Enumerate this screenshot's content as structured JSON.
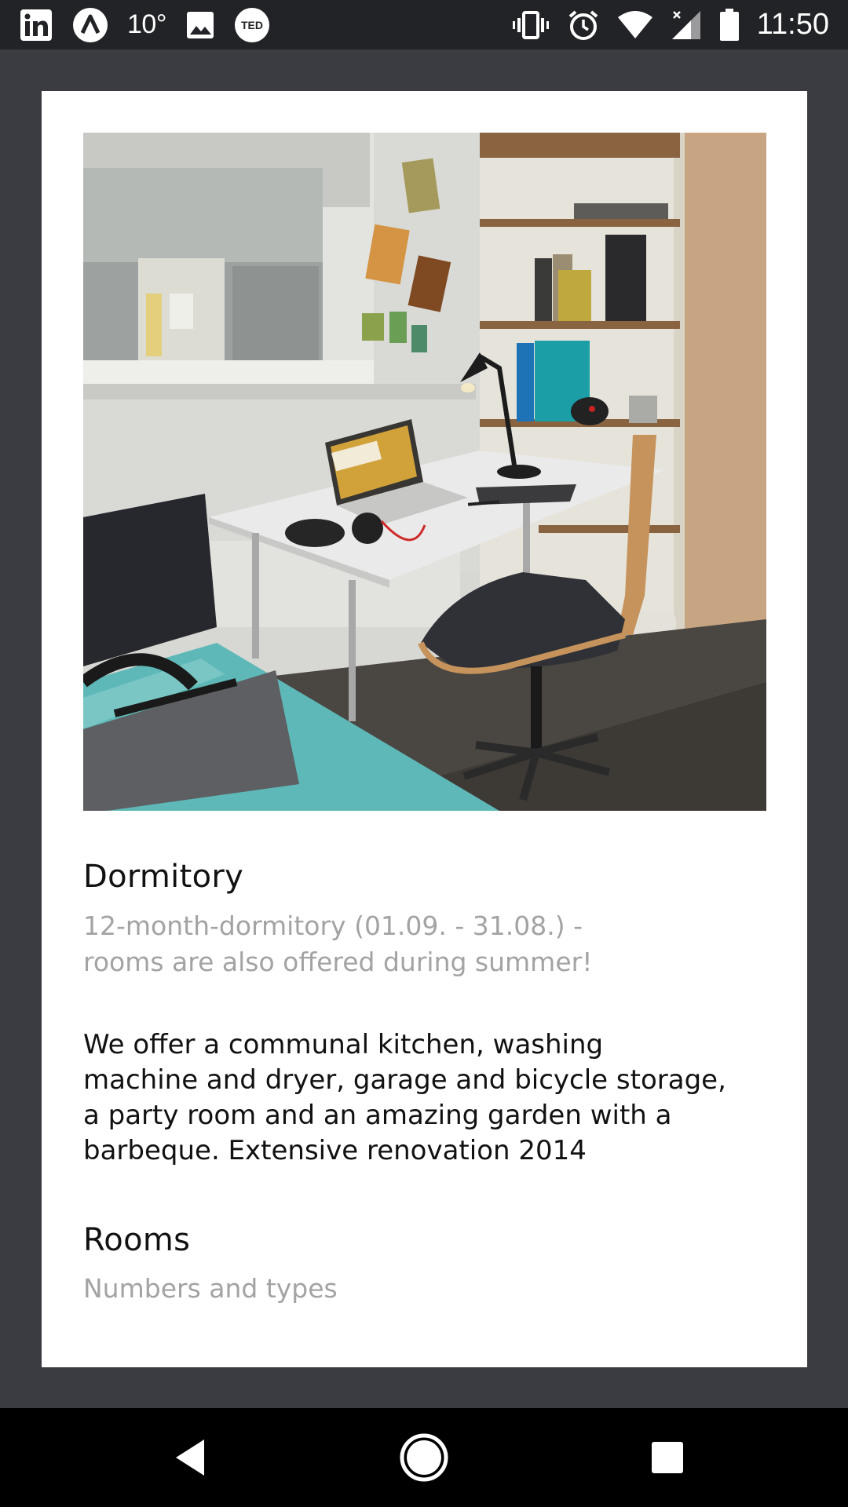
{
  "status_bar": {
    "temperature": "10°",
    "time": "11:50",
    "left_icons": [
      "linkedin-icon",
      "arrow-app-icon",
      "image-icon",
      "ted-icon"
    ],
    "right_icons": [
      "vibrate-icon",
      "alarm-icon",
      "wifi-icon",
      "cell-signal-icon",
      "battery-icon"
    ],
    "ted_label": "TED"
  },
  "card": {
    "image_alt": "Dormitory room photo",
    "title": "Dormitory",
    "subtitle_line1": "12-month-dormitory (01.09. - 31.08.) -",
    "subtitle_line2": "rooms are also offered during summer!",
    "description_line1": "We offer a communal kitchen, washing",
    "description_line2": "machine and dryer, garage and bicycle storage,",
    "description_line3": "a party room and an amazing garden with a",
    "description_line4": "barbeque. Extensive renovation 2014",
    "rooms_title": "Rooms",
    "rooms_subtitle": "Numbers and types"
  },
  "nav_bar": {
    "buttons": [
      "back-icon",
      "home-icon",
      "recents-icon"
    ]
  },
  "colors": {
    "status_bar": "#222326",
    "background": "#3b3c41",
    "card": "#ffffff",
    "muted_text": "#a3a3a3",
    "nav_bar": "#000000"
  }
}
